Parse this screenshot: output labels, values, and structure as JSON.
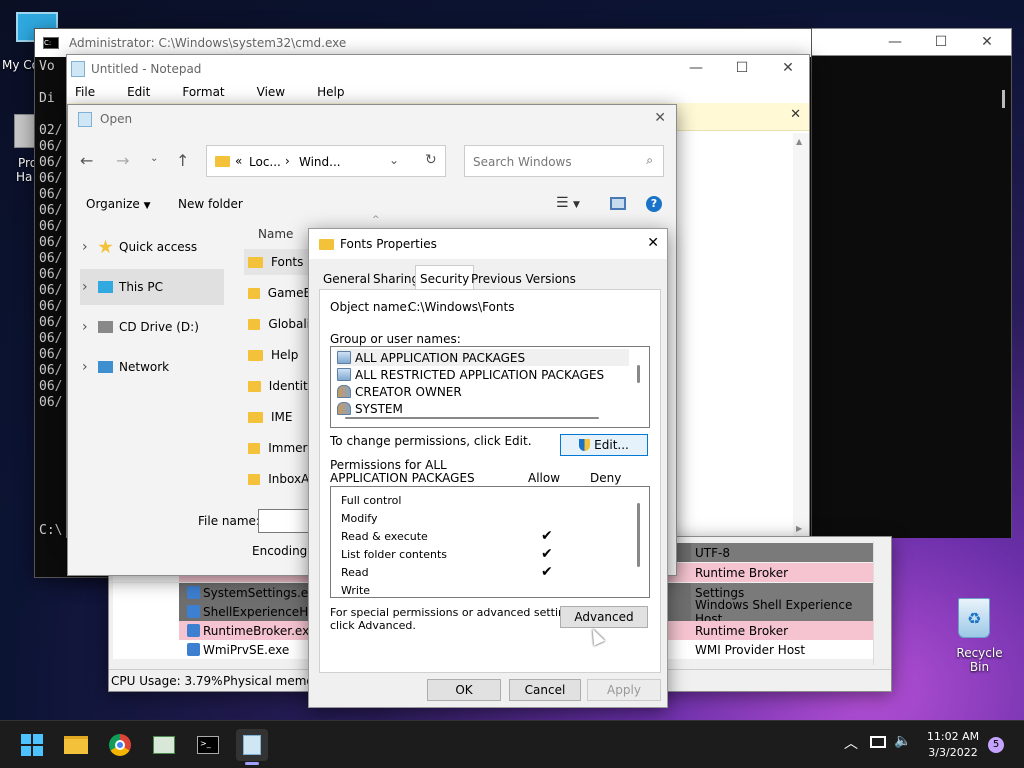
{
  "desktop": {
    "my_computer": "My Co",
    "program": "Pro",
    "program2": "Ha",
    "recycle_bin": "Recycle Bin"
  },
  "cmd": {
    "title": "Administrator: C:\\Windows\\system32\\cmd.exe",
    "lines": [
      "Vo",
      "",
      "Di",
      "",
      "02/",
      "06/",
      "06/",
      "06/",
      "06/",
      "06/",
      "06/",
      "06/",
      "06/",
      "06/",
      "06/",
      "06/",
      "06/",
      "06/",
      "06/",
      "06/",
      "06/",
      "06/"
    ],
    "prompt": "C:\\"
  },
  "notepad": {
    "title": "Untitled - Notepad",
    "menu": [
      "File",
      "Edit",
      "Format",
      "View",
      "Help"
    ]
  },
  "taskmgr": {
    "rows": [
      {
        "name": "",
        "desc": "UTF-8"
      },
      {
        "name": "",
        "desc": "Runtime Broker"
      },
      {
        "name": "SystemSettings.exe",
        "desc": "Settings"
      },
      {
        "name": "ShellExperienceH...",
        "desc": "Windows Shell Experience Host"
      },
      {
        "name": "RuntimeBroker.exe",
        "desc": "Runtime Broker"
      },
      {
        "name": "WmiPrvSE.exe",
        "desc": "WMI Provider Host"
      }
    ],
    "cpu_usage": "CPU Usage: 3.79%",
    "physical_memory": "Physical memor"
  },
  "open_dialog": {
    "title": "Open",
    "breadcrumb_1": "Loc...",
    "breadcrumb_2": "Wind...",
    "search_placeholder": "Search Windows",
    "organize": "Organize",
    "new_folder": "New folder",
    "nav": [
      "Quick access",
      "This PC",
      "CD Drive (D:)",
      "Network"
    ],
    "column_name": "Name",
    "files": [
      "Fonts",
      "GameBa",
      "Globaliz",
      "Help",
      "Identity",
      "IME",
      "Immersi",
      "InboxAp"
    ],
    "file_name_label": "File name:",
    "encoding_label": "Encoding:"
  },
  "props": {
    "title": "Fonts Properties",
    "tabs": [
      "General",
      "Sharing",
      "Security",
      "Previous Versions"
    ],
    "object_name_label": "Object name:",
    "object_name_value": "C:\\Windows\\Fonts",
    "group_label": "Group or user names:",
    "groups": [
      "ALL APPLICATION PACKAGES",
      "ALL RESTRICTED APPLICATION PACKAGES",
      "CREATOR OWNER",
      "SYSTEM"
    ],
    "change_perm_text": "To change permissions, click Edit.",
    "edit_button": "Edit...",
    "perm_for_line1": "Permissions for ALL",
    "perm_for_line2": "APPLICATION PACKAGES",
    "allow": "Allow",
    "deny": "Deny",
    "permissions": [
      {
        "name": "Full control",
        "allow": false
      },
      {
        "name": "Modify",
        "allow": false
      },
      {
        "name": "Read & execute",
        "allow": true
      },
      {
        "name": "List folder contents",
        "allow": true
      },
      {
        "name": "Read",
        "allow": true
      },
      {
        "name": "Write",
        "allow": false
      }
    ],
    "check_mark": "✔",
    "special_line1": "For special permissions or advanced settings,",
    "special_line2": "click Advanced.",
    "advanced_button": "Advanced",
    "ok": "OK",
    "cancel": "Cancel",
    "apply": "Apply"
  },
  "taskbar": {
    "time": "11:02 AM",
    "date": "3/3/2022",
    "notifications": "5"
  }
}
